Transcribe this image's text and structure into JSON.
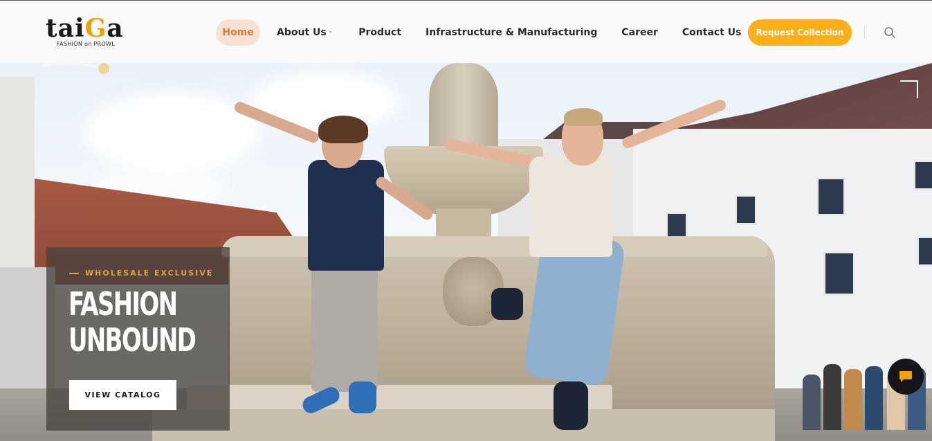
{
  "brand": {
    "name_prefix": "tai",
    "name_accent": "G",
    "name_suffix": "a",
    "tagline": "FASHION on PROWL"
  },
  "nav": {
    "items": [
      {
        "label": "Home",
        "active": true
      },
      {
        "label": "About Us",
        "has_dropdown": true
      },
      {
        "label": "Product"
      },
      {
        "label": "Infrastructure & Manufacturing"
      },
      {
        "label": "Career"
      },
      {
        "label": "Contact Us"
      }
    ]
  },
  "header": {
    "cta_label": "Request Collection",
    "search_icon": "search-icon"
  },
  "hero": {
    "eyebrow": "WHOLESALE EXCLUSIVE",
    "headline_line1": "FASHION",
    "headline_line2": "UNBOUND",
    "button_label": "VIEW CATALOG"
  },
  "colors": {
    "accent": "#fbb01a",
    "home_bg": "#f7e1d3",
    "home_text": "#e07b36",
    "eyebrow": "#e0a040",
    "chat_bg": "#16161a",
    "chat_icon": "#f2a200"
  },
  "icons": {
    "chat": "chat-bubble-icon",
    "dropdown": "chevron-down-icon"
  }
}
